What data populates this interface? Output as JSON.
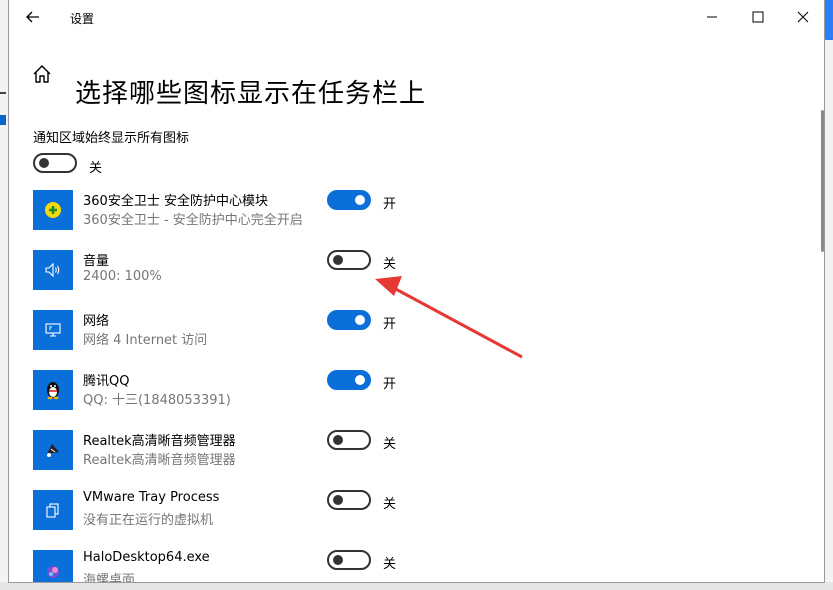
{
  "window": {
    "title": "设置",
    "back_icon": "back-arrow-icon",
    "controls": [
      "minimize-icon",
      "maximize-icon",
      "close-icon"
    ]
  },
  "page": {
    "title": "选择哪些图标显示在任务栏上",
    "home_icon": "home-icon"
  },
  "always_show": {
    "label": "通知区域始终显示所有图标",
    "state": "关",
    "on": false
  },
  "items": [
    {
      "name": "360安全卫士 安全防护中心模块",
      "desc": "360安全卫士 - 安全防护中心完全开启",
      "state": "开",
      "on": true,
      "icon": "360-shield-icon"
    },
    {
      "name": "音量",
      "desc": "2400: 100%",
      "state": "关",
      "on": false,
      "icon": "speaker-icon"
    },
    {
      "name": "网络",
      "desc": "网络 4 Internet 访问",
      "state": "开",
      "on": true,
      "icon": "network-icon"
    },
    {
      "name": "腾讯QQ",
      "desc": "QQ: 十三(1848053391)",
      "state": "开",
      "on": true,
      "icon": "qq-penguin-icon"
    },
    {
      "name": "Realtek高清晰音频管理器",
      "desc": "Realtek高清晰音频管理器",
      "state": "关",
      "on": false,
      "icon": "realtek-audio-icon"
    },
    {
      "name": "VMware Tray Process",
      "desc": "没有正在运行的虚拟机",
      "state": "关",
      "on": false,
      "icon": "vmware-icon"
    },
    {
      "name": "HaloDesktop64.exe",
      "desc": "海螺桌面",
      "state": "关",
      "on": false,
      "icon": "halo-desktop-icon"
    }
  ],
  "colors": {
    "accent": "#0a6fd8",
    "annotation_arrow": "#e53935"
  }
}
